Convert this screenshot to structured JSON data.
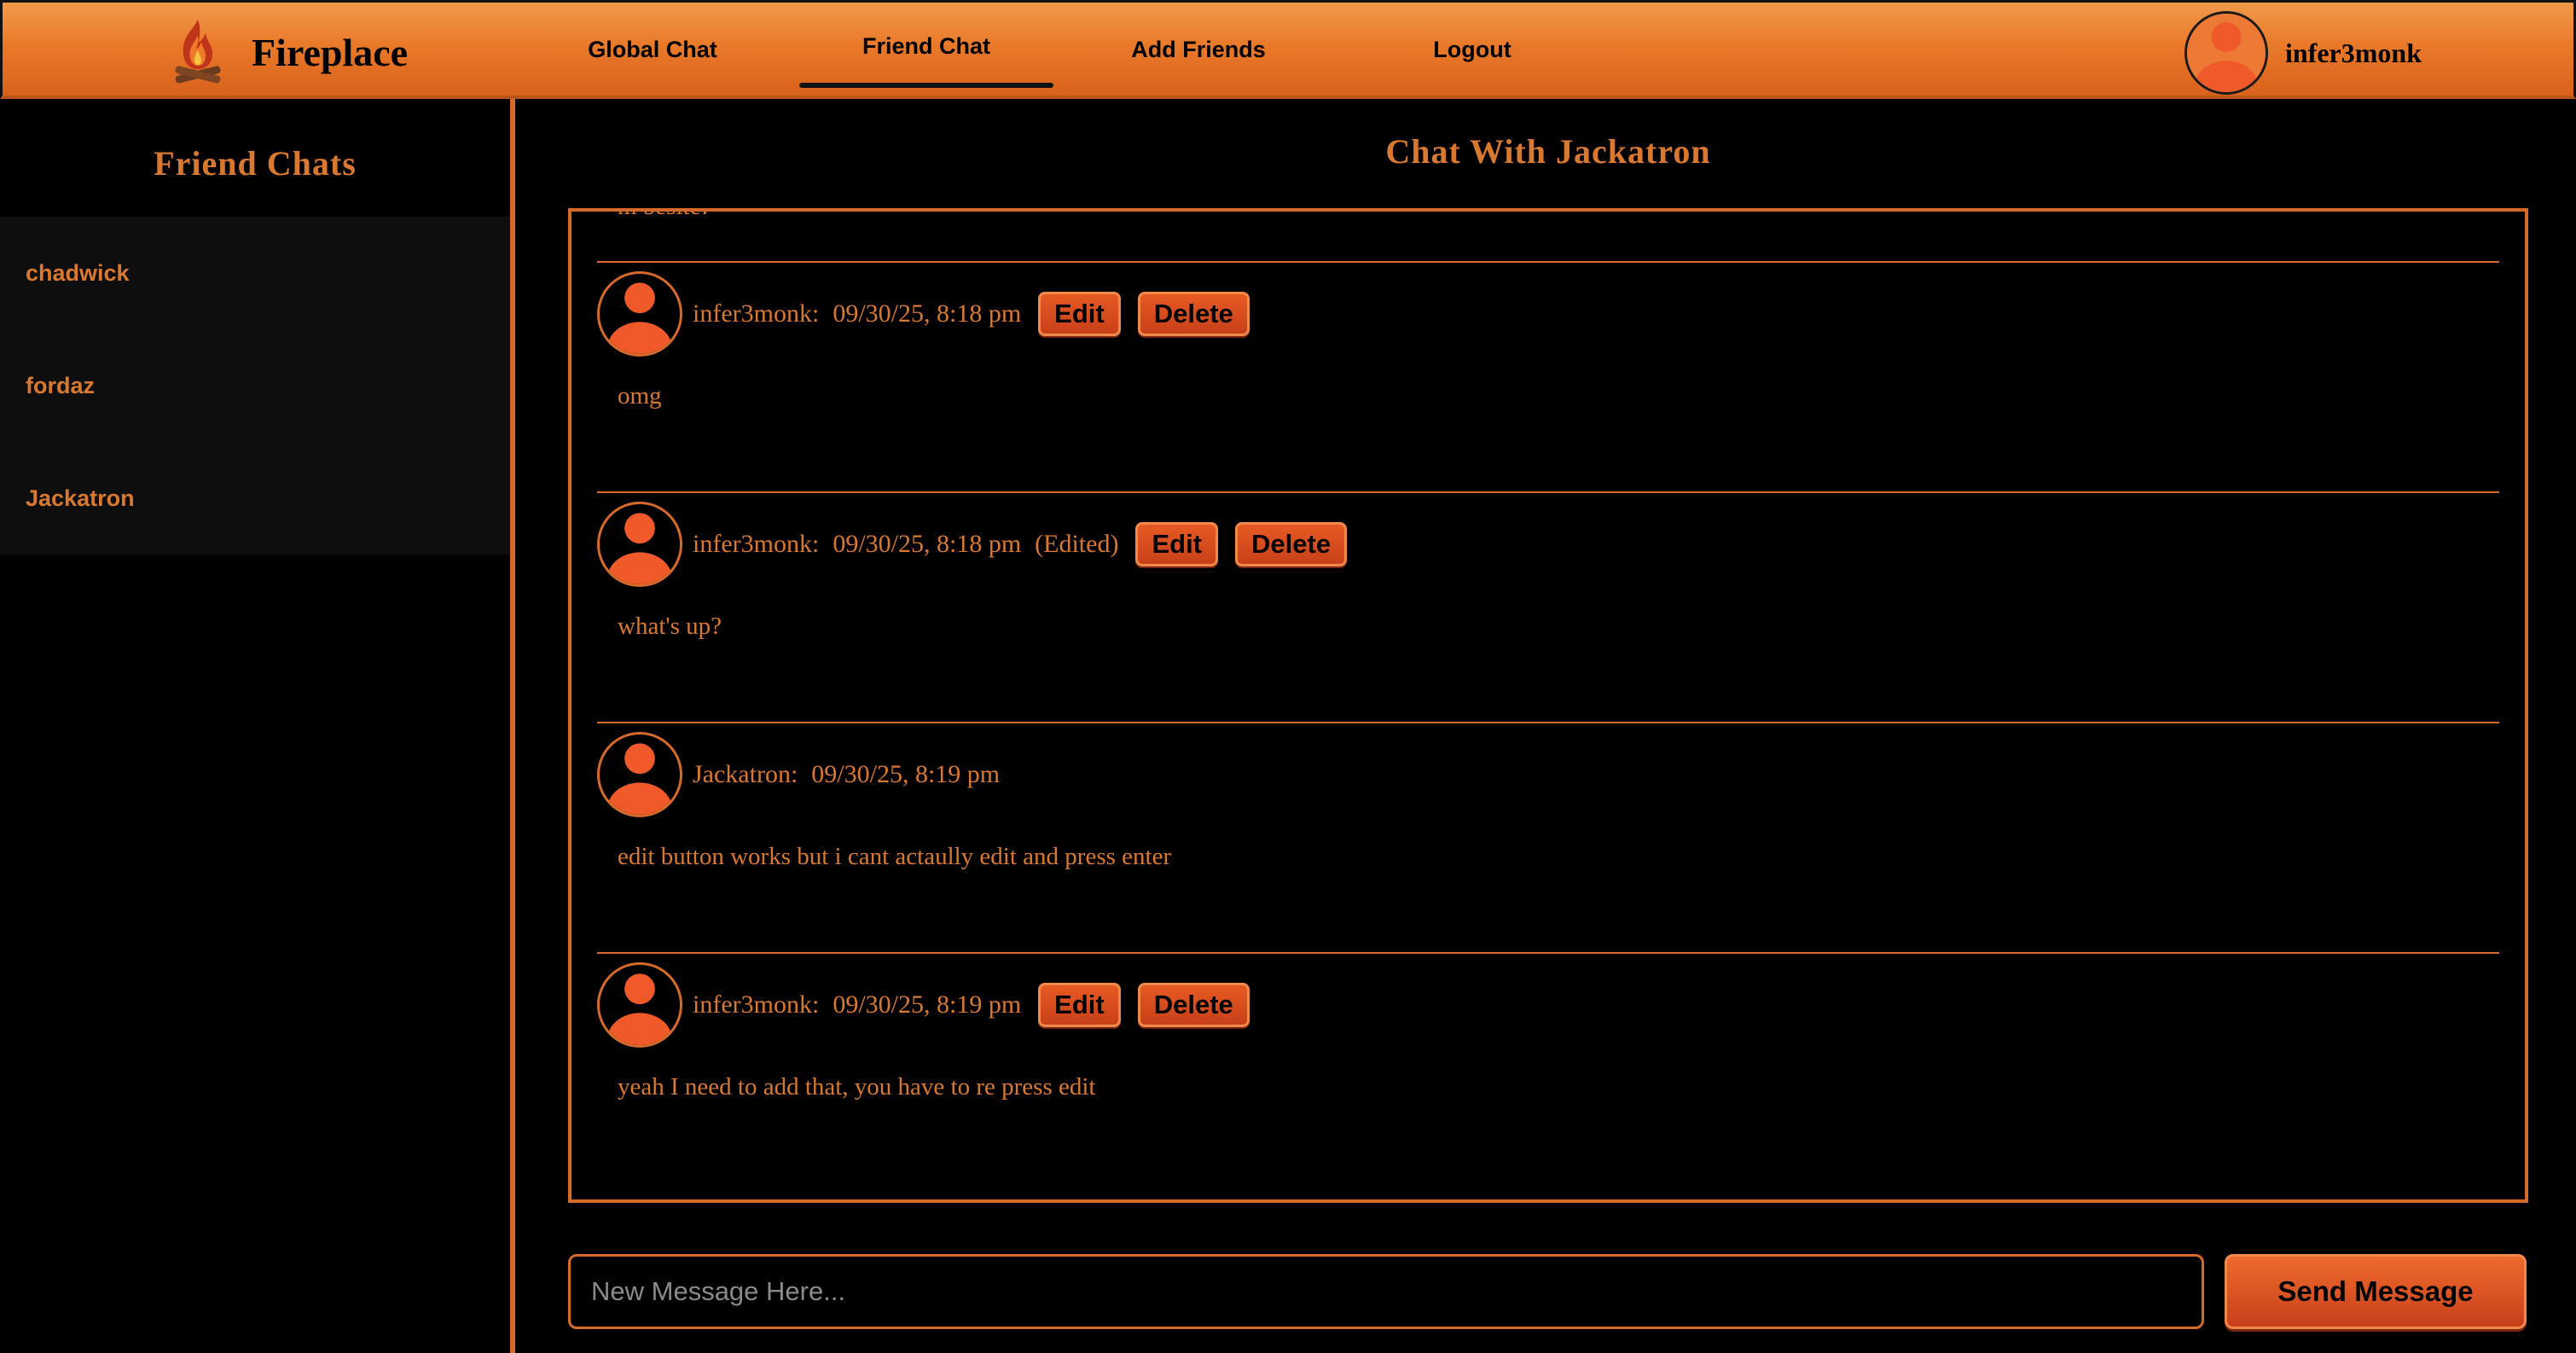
{
  "app": {
    "brand_name": "Fireplace",
    "brand_icon": "campfire-icon",
    "accent_color": "#d9792f",
    "button_color": "#e65a22"
  },
  "nav": {
    "items": [
      {
        "label": "Global Chat"
      },
      {
        "label": "Friend Chat",
        "active": true
      },
      {
        "label": "Add Friends"
      },
      {
        "label": "Logout"
      }
    ]
  },
  "user": {
    "name": "infer3monk",
    "avatar_icon": "user-avatar-icon"
  },
  "sidebar": {
    "title": "Friend Chats",
    "friends": [
      {
        "name": "chadwick"
      },
      {
        "name": "fordaz"
      },
      {
        "name": "Jackatron"
      }
    ]
  },
  "chat": {
    "title": "Chat With Jackatron",
    "partial_message_text": "m besite!",
    "messages": [
      {
        "author": "infer3monk:",
        "time": "09/30/25, 8:18 pm",
        "edited": "",
        "text": "omg",
        "edit_label": "Edit",
        "delete_label": "Delete"
      },
      {
        "author": "infer3monk:",
        "time": "09/30/25, 8:18 pm",
        "edited": "(Edited)",
        "text": "what's up?",
        "edit_label": "Edit",
        "delete_label": "Delete"
      },
      {
        "author": "Jackatron:",
        "time": "09/30/25, 8:19 pm",
        "edited": "",
        "text": "edit button works but i cant actaully edit and press enter"
      },
      {
        "author": "infer3monk:",
        "time": "09/30/25, 8:19 pm",
        "edited": "",
        "text": "yeah I need to add that, you have to re press edit",
        "edit_label": "Edit",
        "delete_label": "Delete"
      }
    ]
  },
  "composer": {
    "value": "",
    "placeholder": "New Message Here...",
    "send_label": "Send Message"
  }
}
